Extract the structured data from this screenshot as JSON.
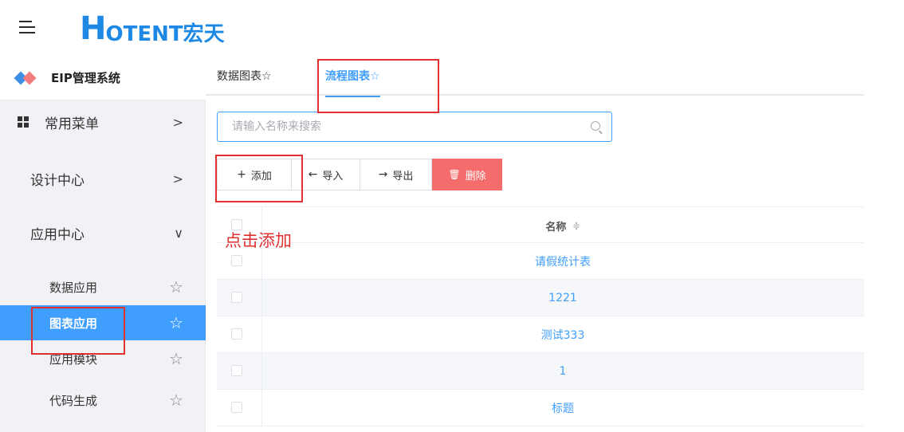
{
  "header": {
    "menu_icon": "hamburger-collapse-icon",
    "logo_initial": "H",
    "logo_rest": "OTENT宏天"
  },
  "sidebar": {
    "system_title": "EIP管理系统",
    "system_icon": "diamond-logo-icon",
    "items": [
      {
        "label": "常用菜单",
        "icon": "grid-icon",
        "chevron": ">"
      },
      {
        "label": "设计中心",
        "chevron": ">"
      },
      {
        "label": "应用中心",
        "chevron": "∨"
      }
    ],
    "sub_items": [
      {
        "label": "数据应用",
        "star": "☆"
      },
      {
        "label": "图表应用",
        "star": "☆"
      },
      {
        "label": "应用模块",
        "star": "☆"
      },
      {
        "label": "代码生成",
        "star": "☆"
      }
    ],
    "active_color": "#409eff"
  },
  "tabs": [
    {
      "label": "数据图表☆"
    },
    {
      "label": "流程图表☆"
    }
  ],
  "search": {
    "placeholder": "请输入名称来搜索",
    "icon": "search-icon"
  },
  "toolbar": {
    "add": {
      "icon": "+",
      "label": "添加"
    },
    "import": {
      "icon": "←",
      "label": "导入"
    },
    "export": {
      "icon": "→",
      "label": "导出"
    },
    "delete": {
      "icon": "🗑",
      "label": "删除"
    }
  },
  "table": {
    "header_name": "名称",
    "sort_icon": "≑",
    "rows": [
      "请假统计表",
      "1221",
      "测试333",
      "1",
      "标题"
    ]
  },
  "annotation": {
    "text": "点击添加",
    "color": "#e03030"
  }
}
